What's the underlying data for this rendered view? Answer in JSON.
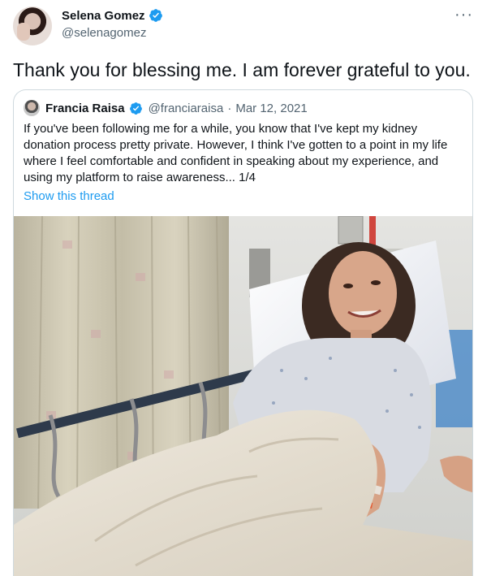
{
  "tweet": {
    "display_name": "Selena Gomez",
    "handle": "@selenagomez",
    "more_label": "···",
    "text": "Thank you for blessing me. I am forever grateful to you."
  },
  "quoted_tweet": {
    "display_name": "Francia Raisa",
    "handle": "@franciaraisa",
    "separator": "·",
    "date": "Mar 12, 2021",
    "text": "If you've been following me for a while, you know that I've kept my kidney donation process pretty private. However, I think I've gotten to a point in my life where I feel comfortable and confident in speaking about my experience, and using my platform to raise awareness... 1/4",
    "thread_link": "Show this thread"
  },
  "colors": {
    "verified": "#1d9bf0",
    "link": "#1d9bf0",
    "secondary_text": "#536471",
    "border": "#cfd9de"
  },
  "icons": {
    "verified": "verified-badge-icon",
    "more": "more-options-icon"
  }
}
